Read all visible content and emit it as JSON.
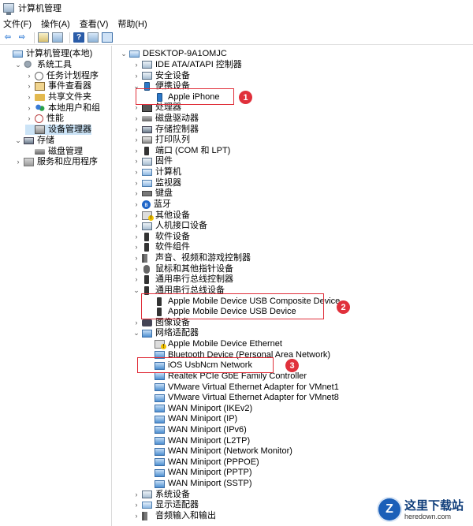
{
  "window": {
    "title": "计算机管理"
  },
  "menu": [
    "文件(F)",
    "操作(A)",
    "查看(V)",
    "帮助(H)"
  ],
  "toolbar": {
    "icons": [
      "back-arrow-icon",
      "forward-arrow-icon",
      "up-folder-icon",
      "show-hide-tree-icon",
      "help-icon",
      "properties-icon",
      "monitor-icon"
    ],
    "back_glyph": "⇦",
    "forward_glyph": "⇨",
    "help_glyph": "?"
  },
  "left_tree": [
    {
      "label": "计算机管理(本地)",
      "level": 0,
      "expander": "",
      "icon": "pc"
    },
    {
      "label": "系统工具",
      "level": 1,
      "expander": "v",
      "icon": "tool"
    },
    {
      "label": "任务计划程序",
      "level": 2,
      "expander": ">",
      "icon": "clock"
    },
    {
      "label": "事件查看器",
      "level": 2,
      "expander": ">",
      "icon": "log"
    },
    {
      "label": "共享文件夹",
      "level": 2,
      "expander": ">",
      "icon": "folder"
    },
    {
      "label": "本地用户和组",
      "level": 2,
      "expander": ">",
      "icon": "users"
    },
    {
      "label": "性能",
      "level": 2,
      "expander": ">",
      "icon": "perf"
    },
    {
      "label": "设备管理器",
      "level": 2,
      "expander": "",
      "icon": "dev",
      "selected": true
    },
    {
      "label": "存储",
      "level": 1,
      "expander": "v",
      "icon": "storage"
    },
    {
      "label": "磁盘管理",
      "level": 2,
      "expander": "",
      "icon": "disk"
    },
    {
      "label": "服务和应用程序",
      "level": 1,
      "expander": ">",
      "icon": "svc"
    }
  ],
  "device_tree": [
    {
      "label": "DESKTOP-9A1OMJC",
      "level": 0,
      "expander": "v",
      "icon": "pc"
    },
    {
      "label": "IDE ATA/ATAPI 控制器",
      "level": 1,
      "expander": ">",
      "icon": "cat"
    },
    {
      "label": "安全设备",
      "level": 1,
      "expander": ">",
      "icon": "cat"
    },
    {
      "label": "便携设备",
      "level": 1,
      "expander": "v",
      "icon": "phone"
    },
    {
      "label": "Apple iPhone",
      "level": 2,
      "expander": "",
      "icon": "phone"
    },
    {
      "label": "处理器",
      "level": 1,
      "expander": ">",
      "icon": "cpu"
    },
    {
      "label": "磁盘驱动器",
      "level": 1,
      "expander": ">",
      "icon": "disk"
    },
    {
      "label": "存储控制器",
      "level": 1,
      "expander": ">",
      "icon": "storage"
    },
    {
      "label": "打印队列",
      "level": 1,
      "expander": ">",
      "icon": "printer"
    },
    {
      "label": "端口 (COM 和 LPT)",
      "level": 1,
      "expander": ">",
      "icon": "usb"
    },
    {
      "label": "固件",
      "level": 1,
      "expander": ">",
      "icon": "cat"
    },
    {
      "label": "计算机",
      "level": 1,
      "expander": ">",
      "icon": "pc"
    },
    {
      "label": "监视器",
      "level": 1,
      "expander": ">",
      "icon": "pc"
    },
    {
      "label": "键盘",
      "level": 1,
      "expander": ">",
      "icon": "kbd"
    },
    {
      "label": "蓝牙",
      "level": 1,
      "expander": ">",
      "icon": "bt"
    },
    {
      "label": "其他设备",
      "level": 1,
      "expander": ">",
      "icon": "warn"
    },
    {
      "label": "人机接口设备",
      "level": 1,
      "expander": ">",
      "icon": "cat"
    },
    {
      "label": "软件设备",
      "level": 1,
      "expander": ">",
      "icon": "usb"
    },
    {
      "label": "软件组件",
      "level": 1,
      "expander": ">",
      "icon": "usb"
    },
    {
      "label": "声音、视频和游戏控制器",
      "level": 1,
      "expander": ">",
      "icon": "speaker"
    },
    {
      "label": "鼠标和其他指针设备",
      "level": 1,
      "expander": ">",
      "icon": "mouse"
    },
    {
      "label": "通用串行总线控制器",
      "level": 1,
      "expander": ">",
      "icon": "usb"
    },
    {
      "label": "通用串行总线设备",
      "level": 1,
      "expander": "v",
      "icon": "usb"
    },
    {
      "label": "Apple Mobile Device USB Composite Device",
      "level": 2,
      "expander": "",
      "icon": "usb"
    },
    {
      "label": "Apple Mobile Device USB Device",
      "level": 2,
      "expander": "",
      "icon": "usb"
    },
    {
      "label": "图像设备",
      "level": 1,
      "expander": ">",
      "icon": "imaging"
    },
    {
      "label": "网络适配器",
      "level": 1,
      "expander": "v",
      "icon": "net"
    },
    {
      "label": "Apple Mobile Device Ethernet",
      "level": 2,
      "expander": "",
      "icon": "warn"
    },
    {
      "label": "Bluetooth Device (Personal Area Network)",
      "level": 2,
      "expander": "",
      "icon": "net"
    },
    {
      "label": "iOS UsbNcm Network",
      "level": 2,
      "expander": "",
      "icon": "net"
    },
    {
      "label": "Realtek PCIe GbE Family Controller",
      "level": 2,
      "expander": "",
      "icon": "net"
    },
    {
      "label": "VMware Virtual Ethernet Adapter for VMnet1",
      "level": 2,
      "expander": "",
      "icon": "net"
    },
    {
      "label": "VMware Virtual Ethernet Adapter for VMnet8",
      "level": 2,
      "expander": "",
      "icon": "net"
    },
    {
      "label": "WAN Miniport (IKEv2)",
      "level": 2,
      "expander": "",
      "icon": "net"
    },
    {
      "label": "WAN Miniport (IP)",
      "level": 2,
      "expander": "",
      "icon": "net"
    },
    {
      "label": "WAN Miniport (IPv6)",
      "level": 2,
      "expander": "",
      "icon": "net"
    },
    {
      "label": "WAN Miniport (L2TP)",
      "level": 2,
      "expander": "",
      "icon": "net"
    },
    {
      "label": "WAN Miniport (Network Monitor)",
      "level": 2,
      "expander": "",
      "icon": "net"
    },
    {
      "label": "WAN Miniport (PPPOE)",
      "level": 2,
      "expander": "",
      "icon": "net"
    },
    {
      "label": "WAN Miniport (PPTP)",
      "level": 2,
      "expander": "",
      "icon": "net"
    },
    {
      "label": "WAN Miniport (SSTP)",
      "level": 2,
      "expander": "",
      "icon": "net"
    },
    {
      "label": "系统设备",
      "level": 1,
      "expander": ">",
      "icon": "cat"
    },
    {
      "label": "显示适配器",
      "level": 1,
      "expander": ">",
      "icon": "pc"
    },
    {
      "label": "音频输入和输出",
      "level": 1,
      "expander": ">",
      "icon": "speaker"
    }
  ],
  "annotations": {
    "color": "#e0303b",
    "badges": [
      "1",
      "2",
      "3"
    ]
  },
  "watermark": {
    "logo_letter": "Z",
    "site_cn": "这里下载站",
    "site_en": "heredown.com"
  }
}
